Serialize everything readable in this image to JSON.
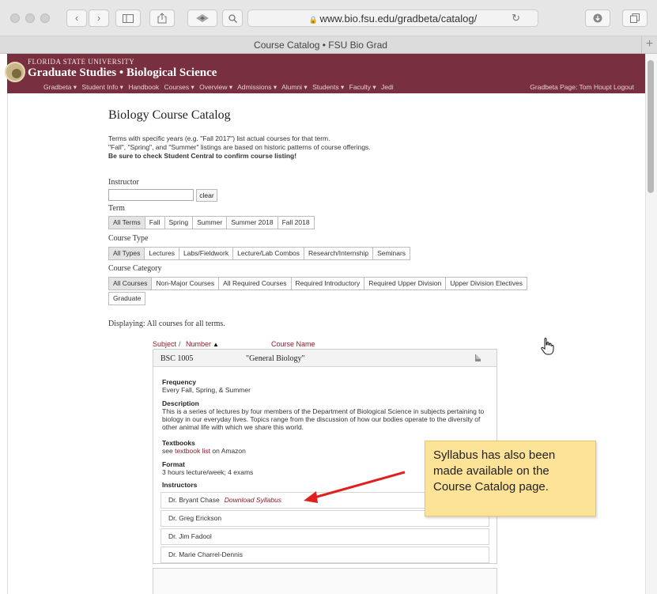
{
  "browser": {
    "url": "www.bio.fsu.edu/gradbeta/catalog/",
    "tab_title": "Course Catalog • FSU Bio Grad",
    "new_tab": "+"
  },
  "header": {
    "university": "FLORIDA STATE UNIVERSITY",
    "site_title": "Graduate Studies • Biological Science",
    "nav": [
      "Gradbeta ▾",
      "Student Info ▾",
      "Handbook",
      "Courses ▾",
      "Overview ▾",
      "Admissions ▾",
      "Alumni ▾",
      "Students ▾",
      "Faculty ▾",
      "Jedi"
    ],
    "user": "Gradbeta Page: Tom Houpt",
    "logout": "Logout"
  },
  "page": {
    "title": "Biology Course Catalog",
    "intro1": "Terms with specific years (e.g. \"Fall 2017\") list actual courses for that term.",
    "intro2": "\"Fall\", \"Spring\", and \"Summer\" listings are based on historic patterns of course offerings.",
    "intro3": "Be sure to check Student Central to confirm course listing!",
    "instructor_label": "Instructor",
    "clear": "clear",
    "term_label": "Term",
    "terms": [
      "All Terms",
      "Fall",
      "Spring",
      "Summer",
      "Summer 2018",
      "Fall 2018"
    ],
    "type_label": "Course Type",
    "types": [
      "All Types",
      "Lectures",
      "Labs/Fieldwork",
      "Lecture/Lab Combos",
      "Research/Internship",
      "Seminars"
    ],
    "category_label": "Course Category",
    "categories_row1": [
      "All Courses",
      "Non-Major Courses",
      "All Required Courses",
      "Required Introductory",
      "Required Upper Division",
      "Upper Division Electives"
    ],
    "categories_row2": [
      "Graduate"
    ],
    "displaying": "Displaying: All courses for all terms."
  },
  "table": {
    "col_subject": "Subject",
    "sep": "/",
    "col_number": "Number",
    "sort_arrow": "▲",
    "col_name": "Course Name"
  },
  "course": {
    "code": "BSC 1005",
    "name": "\"General Biology\"",
    "frequency_label": "Frequency",
    "frequency": "Every Fall, Spring, & Summer",
    "description_label": "Description",
    "description": "This is a series of lectures by four members of the Department of Biological Science in subjects pertaining to biology in our everyday lives. Topics range from the discussion of how our bodies operate to the diversity of other animal life with which we share this world.",
    "textbooks_label": "Textbooks",
    "textbooks_pre": "see",
    "textbooks_link": "textbook list",
    "textbooks_post": "on Amazon",
    "format_label": "Format",
    "format": "3 hours lecture/week; 4 exams",
    "instructors_label": "Instructors",
    "instructors": [
      "Dr. Bryant Chase",
      "Dr. Greg Erickson",
      "Dr. Jim Fadool",
      "Dr. Marie Charrel-Dennis"
    ],
    "syllabus": "Download Syllabus"
  },
  "annotation": "Syllabus has also been made available on the Course Catalog page.",
  "colors": {
    "fsu_garnet": "#782f40",
    "link": "#8b1c2a",
    "note": "#fde397",
    "arrow": "#e02020"
  }
}
